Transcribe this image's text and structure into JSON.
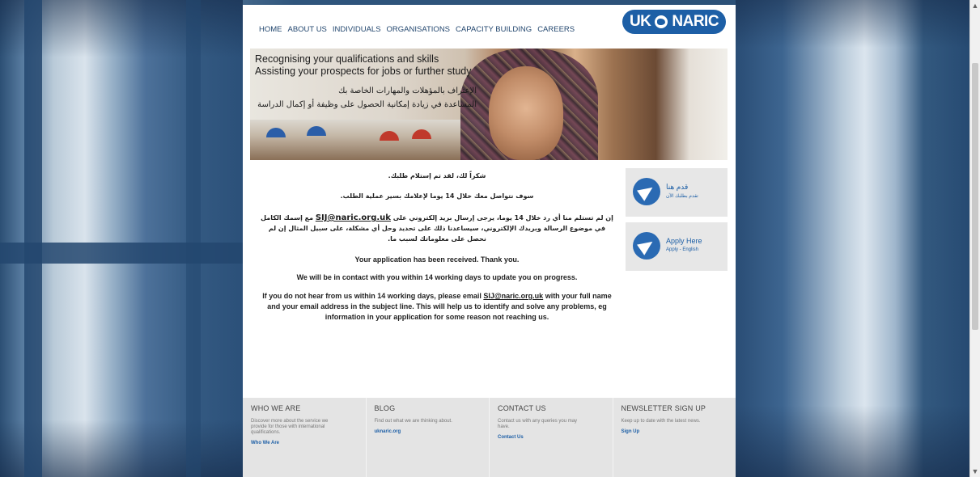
{
  "nav": {
    "items": [
      "HOME",
      "ABOUT US",
      "INDIVIDUALS",
      "ORGANISATIONS",
      "CAPACITY BUILDING",
      "CAREERS"
    ]
  },
  "logo": {
    "left": "UK",
    "right": "NARIC"
  },
  "hero": {
    "line1": "Recognising your qualifications and skills",
    "line2": "Assisting your prospects for jobs or further study",
    "ar1": "الإعتراف بالمؤهلات والمهارات الخاصة بك",
    "ar2": "المساعدة في زيادة إمكانية الحصول على وظيفة أو إكمال الدراسة"
  },
  "content": {
    "ar_thanks": "شكراً لك، لقد تم إستلام طلبك.",
    "ar_contact": "سوف نتواصل معك خلال 14 يوما لإعلامك بسير عملية الطلب.",
    "ar_notice_pre": "إن لم تستلم منا أي رد خلال 14 يوما، يرجى إرسال بريد إلكتروني على",
    "ar_notice_post": "مع إسمك الكامل في موضوع الرسالة وبريدك الإلكتروني، سيساعدنا ذلك على تحديد وحل أي مشكلة، على سبيل المثال إن لم نحصل على معلوماتك لسبب ما.",
    "email": "SIJ@naric.org.uk",
    "en_received": "Your application has been received. Thank you.",
    "en_contact": "We will be in contact with you within 14 working days to update you on progress.",
    "en_notice_pre": "If you do not hear from us within 14 working days, please email",
    "en_notice_post": "with your full name and your email address in the subject line. This will help us to identify and solve any problems, eg information in your application for some reason not reaching us."
  },
  "cards": {
    "ar": {
      "title": "قدم هنا",
      "sub": "تقدم بطلبك الآن"
    },
    "en": {
      "title": "Apply Here",
      "sub": "Apply - English"
    }
  },
  "footer": {
    "who": {
      "heading": "WHO WE ARE",
      "desc": "Discover more about the service we provide for those with international qualifications.",
      "link": "Who We Are"
    },
    "blog": {
      "heading": "BLOG",
      "desc": "Find out what we are thinking about.",
      "link": "uknaric.org"
    },
    "contact": {
      "heading": "CONTACT US",
      "desc": "Contact us with any queries you may have.",
      "link": "Contact Us"
    },
    "news": {
      "heading": "NEWSLETTER SIGN UP",
      "desc": "Keep up to date with the latest news.",
      "link": "Sign Up"
    }
  }
}
